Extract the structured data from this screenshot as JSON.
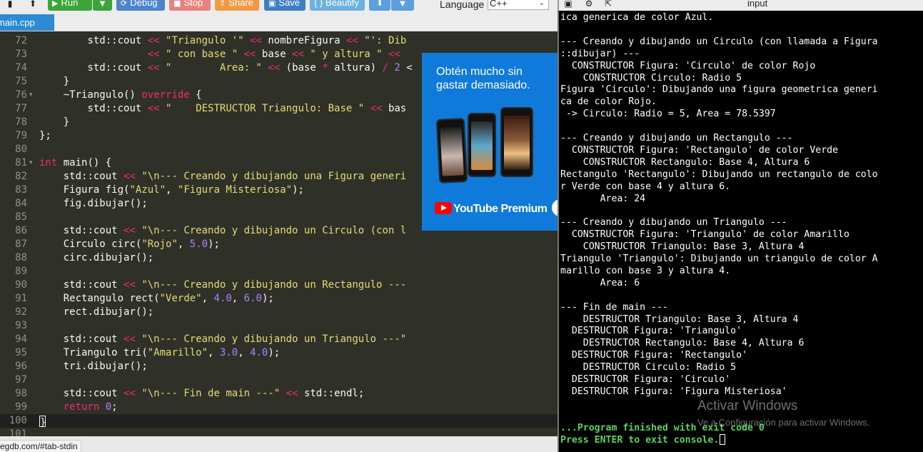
{
  "toolbar": {
    "run_label": "Run",
    "debug_label": "Debug",
    "stop_label": "Stop",
    "share_label": "Share",
    "save_label": "Save",
    "beautify_label": "{ } Beautify",
    "language_label": "Language",
    "language_value": "C++",
    "icons": [
      "file-icon",
      "upload-icon",
      "play-icon",
      "caret-down-icon",
      "debug-icon",
      "stop-icon",
      "share-icon",
      "save-icon",
      "download-icon",
      "caret-down-icon"
    ]
  },
  "editor": {
    "tab_label": "main.cpp",
    "theme_colors": {
      "background": "#2f3129",
      "keyword": "#f92672",
      "string": "#e6db74",
      "number": "#ae81ff",
      "function": "#a6e22e",
      "type": "#66d9ef"
    },
    "lines": [
      {
        "n": "72",
        "fold": false,
        "code": "        std::cout << \"Triangulo '\" << nombreFigura << \"': Dib"
      },
      {
        "n": "73",
        "fold": false,
        "code": "                  << \" con base \" << base << \" y altura \" <<"
      },
      {
        "n": "74",
        "fold": false,
        "code": "        std::cout << \"        Area: \" << (base * altura) / 2 <"
      },
      {
        "n": "75",
        "fold": false,
        "code": "    }"
      },
      {
        "n": "76",
        "fold": true,
        "code": "    ~Triangulo() override {"
      },
      {
        "n": "77",
        "fold": false,
        "code": "        std::cout << \"    DESTRUCTOR Triangulo: Base \" << bas"
      },
      {
        "n": "78",
        "fold": false,
        "code": "    }"
      },
      {
        "n": "79",
        "fold": false,
        "code": "};"
      },
      {
        "n": "80",
        "fold": false,
        "code": ""
      },
      {
        "n": "81",
        "fold": true,
        "code": "int main() {"
      },
      {
        "n": "82",
        "fold": false,
        "code": "    std::cout << \"\\n--- Creando y dibujando una Figura generi"
      },
      {
        "n": "83",
        "fold": false,
        "code": "    Figura fig(\"Azul\", \"Figura Misteriosa\");"
      },
      {
        "n": "84",
        "fold": false,
        "code": "    fig.dibujar();"
      },
      {
        "n": "85",
        "fold": false,
        "code": ""
      },
      {
        "n": "86",
        "fold": false,
        "code": "    std::cout << \"\\n--- Creando y dibujando un Circulo (con l"
      },
      {
        "n": "87",
        "fold": false,
        "code": "    Circulo circ(\"Rojo\", 5.0);"
      },
      {
        "n": "88",
        "fold": false,
        "code": "    circ.dibujar();"
      },
      {
        "n": "89",
        "fold": false,
        "code": ""
      },
      {
        "n": "90",
        "fold": false,
        "code": "    std::cout << \"\\n--- Creando y dibujando un Rectangulo ---"
      },
      {
        "n": "91",
        "fold": false,
        "code": "    Rectangulo rect(\"Verde\", 4.0, 6.0);"
      },
      {
        "n": "92",
        "fold": false,
        "code": "    rect.dibujar();"
      },
      {
        "n": "93",
        "fold": false,
        "code": ""
      },
      {
        "n": "94",
        "fold": false,
        "code": "    std::cout << \"\\n--- Creando y dibujando un Triangulo ---\""
      },
      {
        "n": "95",
        "fold": false,
        "code": "    Triangulo tri(\"Amarillo\", 3.0, 4.0);"
      },
      {
        "n": "96",
        "fold": false,
        "code": "    tri.dibujar();"
      },
      {
        "n": "97",
        "fold": false,
        "code": ""
      },
      {
        "n": "98",
        "fold": false,
        "code": "    std::cout << \"\\n--- Fin de main ---\" << std::endl;"
      },
      {
        "n": "99",
        "fold": false,
        "code": "    return 0;"
      },
      {
        "n": "100",
        "fold": false,
        "code": "}"
      },
      {
        "n": "101",
        "fold": false,
        "code": ""
      }
    ],
    "active_line": "100"
  },
  "ad": {
    "headline": "Obtén mucho sin gastar demasiado.",
    "brand": "YouTube Premium"
  },
  "status_bar": {
    "url": "egdb.com/#tab-stdin"
  },
  "console": {
    "title": "input",
    "lines": [
      {
        "text": "ica generica de color Azul.",
        "style": "normal"
      },
      {
        "text": "",
        "style": "normal"
      },
      {
        "text": "--- Creando y dibujando un Circulo (con llamada a Figura",
        "style": "normal"
      },
      {
        "text": "::dibujar) ---",
        "style": "normal"
      },
      {
        "text": "  CONSTRUCTOR Figura: 'Circulo' de color Rojo",
        "style": "normal"
      },
      {
        "text": "    CONSTRUCTOR Circulo: Radio 5",
        "style": "normal"
      },
      {
        "text": "Figura 'Circulo': Dibujando una figura geometrica generi",
        "style": "normal"
      },
      {
        "text": "ca de color Rojo.",
        "style": "normal"
      },
      {
        "text": " -> Circulo: Radio = 5, Area = 78.5397",
        "style": "normal"
      },
      {
        "text": "",
        "style": "normal"
      },
      {
        "text": "--- Creando y dibujando un Rectangulo ---",
        "style": "normal"
      },
      {
        "text": "  CONSTRUCTOR Figura: 'Rectangulo' de color Verde",
        "style": "normal"
      },
      {
        "text": "    CONSTRUCTOR Rectangulo: Base 4, Altura 6",
        "style": "normal"
      },
      {
        "text": "Rectangulo 'Rectangulo': Dibujando un rectangulo de colo",
        "style": "normal"
      },
      {
        "text": "r Verde con base 4 y altura 6.",
        "style": "normal"
      },
      {
        "text": "       Area: 24",
        "style": "normal"
      },
      {
        "text": "",
        "style": "normal"
      },
      {
        "text": "--- Creando y dibujando un Triangulo ---",
        "style": "normal"
      },
      {
        "text": "  CONSTRUCTOR Figura: 'Triangulo' de color Amarillo",
        "style": "normal"
      },
      {
        "text": "    CONSTRUCTOR Triangulo: Base 3, Altura 4",
        "style": "normal"
      },
      {
        "text": "Triangulo 'Triangulo': Dibujando un triangulo de color A",
        "style": "normal"
      },
      {
        "text": "marillo con base 3 y altura 4.",
        "style": "normal"
      },
      {
        "text": "       Area: 6",
        "style": "normal"
      },
      {
        "text": "",
        "style": "normal"
      },
      {
        "text": "--- Fin de main ---",
        "style": "normal"
      },
      {
        "text": "    DESTRUCTOR Triangulo: Base 3, Altura 4",
        "style": "normal"
      },
      {
        "text": "  DESTRUCTOR Figura: 'Triangulo'",
        "style": "normal"
      },
      {
        "text": "    DESTRUCTOR Rectangulo: Base 4, Altura 6",
        "style": "normal"
      },
      {
        "text": "  DESTRUCTOR Figura: 'Rectangulo'",
        "style": "normal"
      },
      {
        "text": "    DESTRUCTOR Circulo: Radio 5",
        "style": "normal"
      },
      {
        "text": "  DESTRUCTOR Figura: 'Circulo'",
        "style": "normal"
      },
      {
        "text": "  DESTRUCTOR Figura: 'Figura Misteriosa'",
        "style": "normal"
      },
      {
        "text": "",
        "style": "normal"
      },
      {
        "text": "",
        "style": "normal"
      },
      {
        "text": "...Program finished with exit code 0",
        "style": "green"
      },
      {
        "text": "Press ENTER to exit console.",
        "style": "green"
      }
    ],
    "header_icons": [
      "expand-icon",
      "gear-icon",
      "share-icon"
    ]
  },
  "watermark": {
    "title": "Activar Windows",
    "subtitle": "Ve a Configuración para activar Windows."
  }
}
